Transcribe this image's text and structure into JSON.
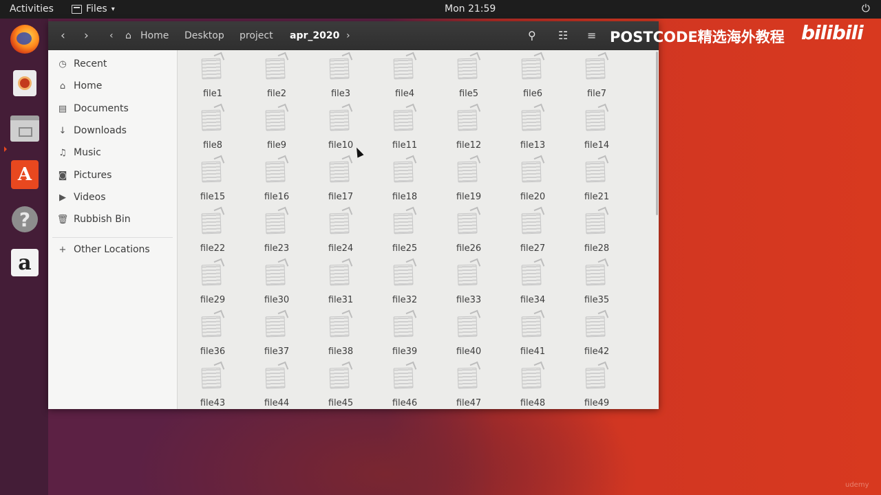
{
  "topbar": {
    "activities": "Activities",
    "app_menu": "Files",
    "app_menu_caret": "▾",
    "clock": "Mon 21:59",
    "power_icon": "⏻"
  },
  "dock": {
    "items": [
      "firefox-icon",
      "rhythmbox-icon",
      "files-icon",
      "software-icon",
      "help-icon",
      "amazon-icon"
    ],
    "software_glyph": "A",
    "help_glyph": "?",
    "amazon_glyph": "a"
  },
  "header": {
    "back": "‹",
    "forward": "›",
    "crumb_left": "‹",
    "crumb_right": "›",
    "home_icon": "⌂",
    "breadcrumbs": [
      "Home",
      "Desktop",
      "project",
      "apr_2020"
    ],
    "search_icon": "⚲",
    "view_icon": "☷",
    "menu_icon": "≡"
  },
  "watermark": {
    "text": "POSTCODE精选海外教程",
    "logo": "bilibili",
    "corner": "udemy"
  },
  "sidebar": {
    "items": [
      {
        "label": "Recent",
        "icon": "◷"
      },
      {
        "label": "Home",
        "icon": "⌂"
      },
      {
        "label": "Documents",
        "icon": "▤"
      },
      {
        "label": "Downloads",
        "icon": "↓"
      },
      {
        "label": "Music",
        "icon": "♫"
      },
      {
        "label": "Pictures",
        "icon": "◙"
      },
      {
        "label": "Videos",
        "icon": "▶"
      },
      {
        "label": "Rubbish Bin",
        "icon": "🗑"
      },
      {
        "label": "Other Locations",
        "icon": "+"
      }
    ]
  },
  "files": [
    "file1",
    "file2",
    "file3",
    "file4",
    "file5",
    "file6",
    "file7",
    "file8",
    "file9",
    "file10",
    "file11",
    "file12",
    "file13",
    "file14",
    "file15",
    "file16",
    "file17",
    "file18",
    "file19",
    "file20",
    "file21",
    "file22",
    "file23",
    "file24",
    "file25",
    "file26",
    "file27",
    "file28",
    "file29",
    "file30",
    "file31",
    "file32",
    "file33",
    "file34",
    "file35",
    "file36",
    "file37",
    "file38",
    "file39",
    "file40",
    "file41",
    "file42",
    "file43",
    "file44",
    "file45",
    "file46",
    "file47",
    "file48",
    "file49"
  ]
}
